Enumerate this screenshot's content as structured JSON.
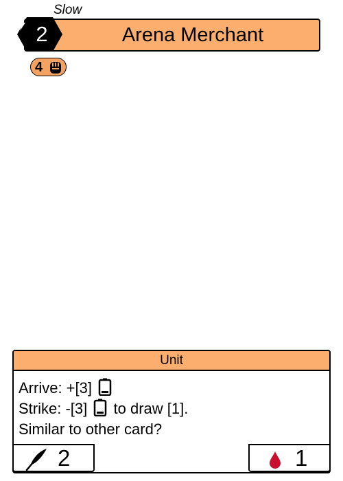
{
  "card": {
    "speed": "Slow",
    "cost": "2",
    "name": "Arena Merchant",
    "strength": "4",
    "type": "Unit",
    "text_lines": [
      {
        "before": "Arrive: +[3]",
        "after": ""
      },
      {
        "before": "Strike: -[3]",
        "after": "to draw [1]."
      },
      {
        "before": "Similar to other card?",
        "after": ""
      }
    ],
    "footer_left_value": "2",
    "footer_right_value": "1"
  },
  "colors": {
    "header": "#fbae6e",
    "badge": "#f4a262",
    "blood": "#c8102e"
  },
  "icons": {
    "cost": "bolt-icon",
    "strength": "fist-icon",
    "energy": "battery-icon",
    "left": "quill-icon",
    "right": "blood-drop-icon"
  }
}
